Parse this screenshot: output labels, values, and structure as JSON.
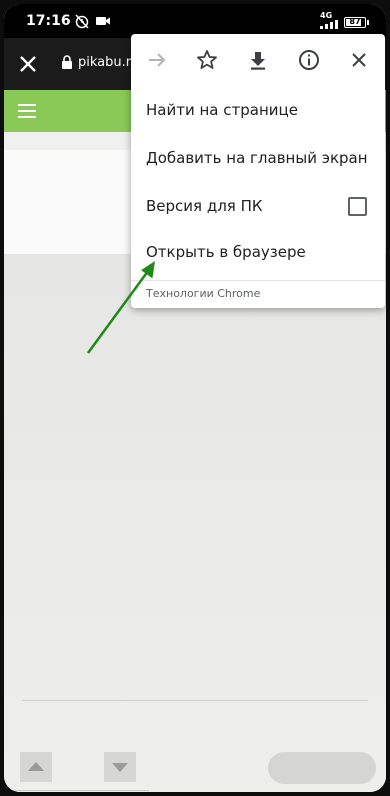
{
  "status_bar": {
    "time": "17:16",
    "network": "4G",
    "battery": "87",
    "battery_level": 0.87,
    "icons": [
      "alarm-off-icon",
      "video-recording-icon",
      "signal-icon",
      "battery-icon"
    ]
  },
  "toolbar": {
    "url": "pikabu.ru",
    "icons": [
      "close-icon",
      "lock-icon"
    ]
  },
  "menu": {
    "icons": [
      "forward-icon",
      "star-icon",
      "download-icon",
      "info-icon",
      "close-icon"
    ],
    "items": [
      {
        "label": "Найти на странице"
      },
      {
        "label": "Добавить на главный экран"
      },
      {
        "label": "Версия для ПК",
        "checked": false
      },
      {
        "label": "Открыть в браузере"
      }
    ],
    "footer": "Технологии Chrome"
  },
  "colors": {
    "site_header": "#8ac858",
    "annotation_arrow": "#1f8a17",
    "toolbar": "#1b1b1b"
  }
}
